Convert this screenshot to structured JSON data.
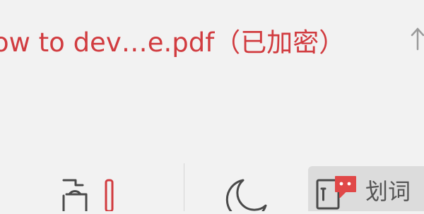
{
  "header": {
    "document_title": "ow to dev…e.pdf（已加密）",
    "title_color": "#d13b3f",
    "collapse_icon": "arrow-up-icon"
  },
  "toolbar": {
    "items": [
      {
        "name": "page-layout-tool",
        "icon": "page-layout-icon",
        "accent": "#d13b3f"
      },
      {
        "name": "night-mode-tool",
        "icon": "moon-icon"
      },
      {
        "name": "word-lookup-tool",
        "icon": "dictionary-icon",
        "badge_icon": "chat-bubble-icon",
        "badge_color": "#e04848",
        "label": "划词"
      }
    ]
  }
}
